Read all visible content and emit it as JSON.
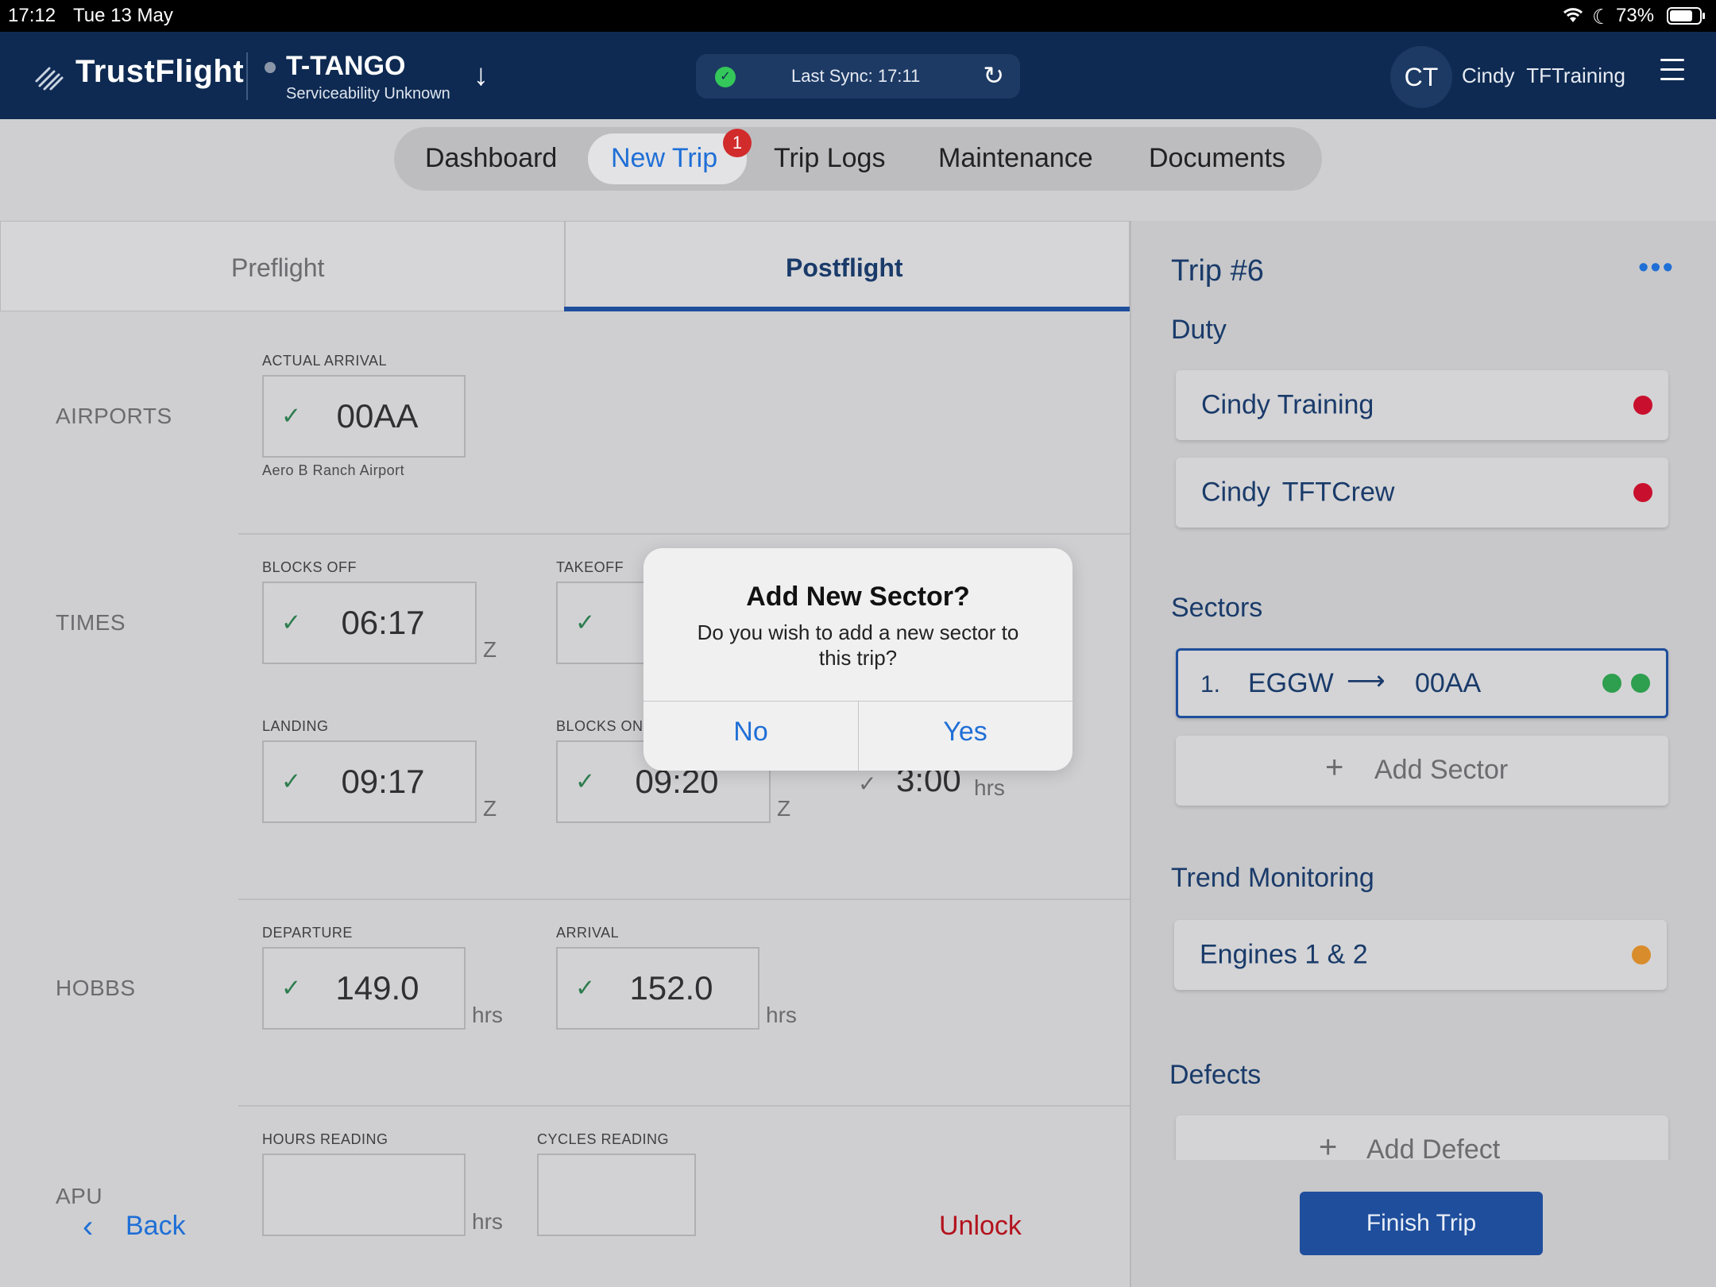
{
  "status_bar": {
    "time": "17:12",
    "date": "Tue 13 May",
    "battery": "73%"
  },
  "header": {
    "brand": "TrustFlight",
    "aircraft_reg": "T-TANGO",
    "aircraft_status": "Serviceability Unknown",
    "sync_text": "Last Sync: 17:11",
    "avatar_initials": "CT",
    "user_name": "Cindy TFTraining"
  },
  "nav": {
    "tabs": [
      "Dashboard",
      "New Trip",
      "Trip Logs",
      "Maintenance",
      "Documents"
    ],
    "active": "New Trip",
    "badge": "1"
  },
  "segments": {
    "preflight": "Preflight",
    "postflight": "Postflight"
  },
  "form": {
    "airports": {
      "section": "AIRPORTS",
      "actual_arrival_label": "ACTUAL ARRIVAL",
      "actual_arrival_value": "00AA",
      "actual_arrival_name": "Aero B Ranch Airport"
    },
    "times": {
      "section": "TIMES",
      "blocks_off_label": "BLOCKS OFF",
      "blocks_off_value": "06:17",
      "takeoff_label": "TAKEOFF",
      "landing_label": "LANDING",
      "landing_value": "09:17",
      "blocks_on_label": "BLOCKS ON",
      "blocks_on_value": "09:20",
      "duration_value": "3:00",
      "zulu": "Z",
      "hrs": "hrs"
    },
    "hobbs": {
      "section": "HOBBS",
      "departure_label": "DEPARTURE",
      "departure_value": "149.0",
      "arrival_label": "ARRIVAL",
      "arrival_value": "152.0",
      "hrs": "hrs"
    },
    "apu": {
      "section": "APU",
      "hours_label": "HOURS READING",
      "cycles_label": "CYCLES READING",
      "hrs": "hrs"
    }
  },
  "footer": {
    "back": "Back",
    "unlock": "Unlock"
  },
  "trip": {
    "title": "Trip #6",
    "duty_heading": "Duty",
    "duty": [
      "Cindy Training",
      "Cindy TFTCrew"
    ],
    "sectors_heading": "Sectors",
    "sector": {
      "index": "1.",
      "from": "EGGW",
      "to": "00AA"
    },
    "add_sector": "Add Sector",
    "trend_heading": "Trend Monitoring",
    "trend_item": "Engines 1 & 2",
    "defects_heading": "Defects",
    "add_defect": "Add Defect",
    "finish": "Finish Trip"
  },
  "dialog": {
    "title": "Add New Sector?",
    "message": "Do you wish to add a new sector to this trip?",
    "no": "No",
    "yes": "Yes"
  },
  "colors": {
    "navy": "#0e2a52",
    "accent": "#1f4e9c",
    "danger": "#c8102e",
    "ok": "#2e9e4f",
    "warn": "#d98c2b",
    "unlock": "#b3121d"
  }
}
